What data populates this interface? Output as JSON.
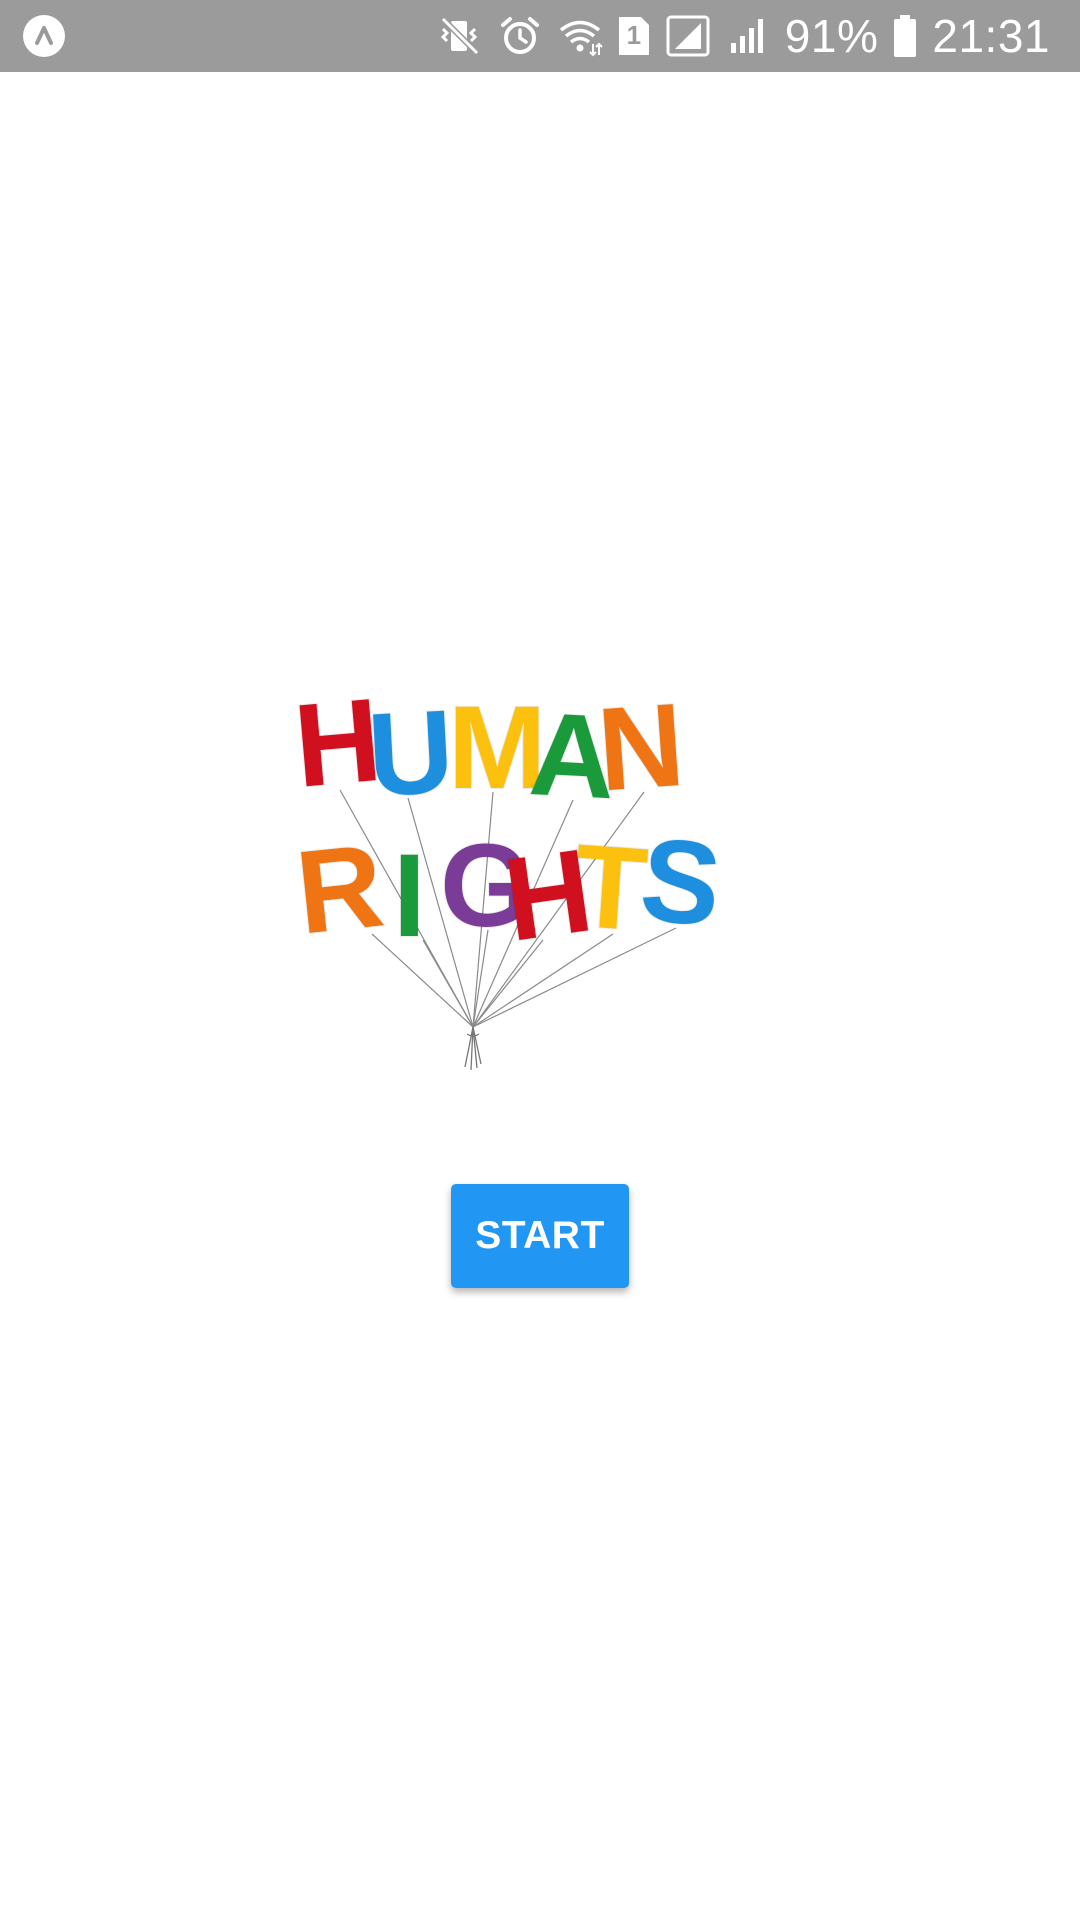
{
  "status_bar": {
    "battery_percent": "91%",
    "time": "21:31",
    "sim_slot": "1",
    "icons": [
      "app-notification-icon",
      "vibrate-mute-icon",
      "alarm-icon",
      "wifi-icon",
      "sim-1-icon",
      "signal-strength-icon",
      "signal-strength-2-icon",
      "battery-icon"
    ]
  },
  "logo": {
    "row1": [
      "H",
      "U",
      "M",
      "A",
      "N"
    ],
    "row2": [
      "R",
      "I",
      "G",
      "H",
      "T",
      "S"
    ],
    "colors": {
      "red": "#d0101e",
      "blue": "#1d8fde",
      "yellow": "#fcc10f",
      "green": "#1a9a3a",
      "orange": "#ee7414",
      "purple": "#7a3c96"
    }
  },
  "main": {
    "start_label": "START",
    "button_color": "#2196f3"
  }
}
